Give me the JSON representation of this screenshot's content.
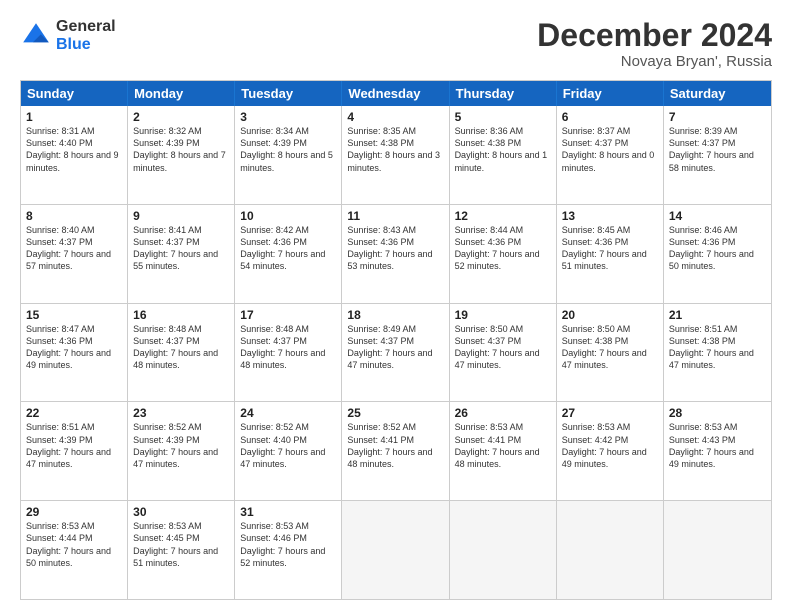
{
  "header": {
    "logo_line1": "General",
    "logo_line2": "Blue",
    "month_title": "December 2024",
    "subtitle": "Novaya Bryan', Russia"
  },
  "days_of_week": [
    "Sunday",
    "Monday",
    "Tuesday",
    "Wednesday",
    "Thursday",
    "Friday",
    "Saturday"
  ],
  "weeks": [
    [
      {
        "day": "1",
        "text": "Sunrise: 8:31 AM\nSunset: 4:40 PM\nDaylight: 8 hours and 9 minutes."
      },
      {
        "day": "2",
        "text": "Sunrise: 8:32 AM\nSunset: 4:39 PM\nDaylight: 8 hours and 7 minutes."
      },
      {
        "day": "3",
        "text": "Sunrise: 8:34 AM\nSunset: 4:39 PM\nDaylight: 8 hours and 5 minutes."
      },
      {
        "day": "4",
        "text": "Sunrise: 8:35 AM\nSunset: 4:38 PM\nDaylight: 8 hours and 3 minutes."
      },
      {
        "day": "5",
        "text": "Sunrise: 8:36 AM\nSunset: 4:38 PM\nDaylight: 8 hours and 1 minute."
      },
      {
        "day": "6",
        "text": "Sunrise: 8:37 AM\nSunset: 4:37 PM\nDaylight: 8 hours and 0 minutes."
      },
      {
        "day": "7",
        "text": "Sunrise: 8:39 AM\nSunset: 4:37 PM\nDaylight: 7 hours and 58 minutes."
      }
    ],
    [
      {
        "day": "8",
        "text": "Sunrise: 8:40 AM\nSunset: 4:37 PM\nDaylight: 7 hours and 57 minutes."
      },
      {
        "day": "9",
        "text": "Sunrise: 8:41 AM\nSunset: 4:37 PM\nDaylight: 7 hours and 55 minutes."
      },
      {
        "day": "10",
        "text": "Sunrise: 8:42 AM\nSunset: 4:36 PM\nDaylight: 7 hours and 54 minutes."
      },
      {
        "day": "11",
        "text": "Sunrise: 8:43 AM\nSunset: 4:36 PM\nDaylight: 7 hours and 53 minutes."
      },
      {
        "day": "12",
        "text": "Sunrise: 8:44 AM\nSunset: 4:36 PM\nDaylight: 7 hours and 52 minutes."
      },
      {
        "day": "13",
        "text": "Sunrise: 8:45 AM\nSunset: 4:36 PM\nDaylight: 7 hours and 51 minutes."
      },
      {
        "day": "14",
        "text": "Sunrise: 8:46 AM\nSunset: 4:36 PM\nDaylight: 7 hours and 50 minutes."
      }
    ],
    [
      {
        "day": "15",
        "text": "Sunrise: 8:47 AM\nSunset: 4:36 PM\nDaylight: 7 hours and 49 minutes."
      },
      {
        "day": "16",
        "text": "Sunrise: 8:48 AM\nSunset: 4:37 PM\nDaylight: 7 hours and 48 minutes."
      },
      {
        "day": "17",
        "text": "Sunrise: 8:48 AM\nSunset: 4:37 PM\nDaylight: 7 hours and 48 minutes."
      },
      {
        "day": "18",
        "text": "Sunrise: 8:49 AM\nSunset: 4:37 PM\nDaylight: 7 hours and 47 minutes."
      },
      {
        "day": "19",
        "text": "Sunrise: 8:50 AM\nSunset: 4:37 PM\nDaylight: 7 hours and 47 minutes."
      },
      {
        "day": "20",
        "text": "Sunrise: 8:50 AM\nSunset: 4:38 PM\nDaylight: 7 hours and 47 minutes."
      },
      {
        "day": "21",
        "text": "Sunrise: 8:51 AM\nSunset: 4:38 PM\nDaylight: 7 hours and 47 minutes."
      }
    ],
    [
      {
        "day": "22",
        "text": "Sunrise: 8:51 AM\nSunset: 4:39 PM\nDaylight: 7 hours and 47 minutes."
      },
      {
        "day": "23",
        "text": "Sunrise: 8:52 AM\nSunset: 4:39 PM\nDaylight: 7 hours and 47 minutes."
      },
      {
        "day": "24",
        "text": "Sunrise: 8:52 AM\nSunset: 4:40 PM\nDaylight: 7 hours and 47 minutes."
      },
      {
        "day": "25",
        "text": "Sunrise: 8:52 AM\nSunset: 4:41 PM\nDaylight: 7 hours and 48 minutes."
      },
      {
        "day": "26",
        "text": "Sunrise: 8:53 AM\nSunset: 4:41 PM\nDaylight: 7 hours and 48 minutes."
      },
      {
        "day": "27",
        "text": "Sunrise: 8:53 AM\nSunset: 4:42 PM\nDaylight: 7 hours and 49 minutes."
      },
      {
        "day": "28",
        "text": "Sunrise: 8:53 AM\nSunset: 4:43 PM\nDaylight: 7 hours and 49 minutes."
      }
    ],
    [
      {
        "day": "29",
        "text": "Sunrise: 8:53 AM\nSunset: 4:44 PM\nDaylight: 7 hours and 50 minutes."
      },
      {
        "day": "30",
        "text": "Sunrise: 8:53 AM\nSunset: 4:45 PM\nDaylight: 7 hours and 51 minutes."
      },
      {
        "day": "31",
        "text": "Sunrise: 8:53 AM\nSunset: 4:46 PM\nDaylight: 7 hours and 52 minutes."
      },
      {
        "day": "",
        "text": ""
      },
      {
        "day": "",
        "text": ""
      },
      {
        "day": "",
        "text": ""
      },
      {
        "day": "",
        "text": ""
      }
    ]
  ]
}
